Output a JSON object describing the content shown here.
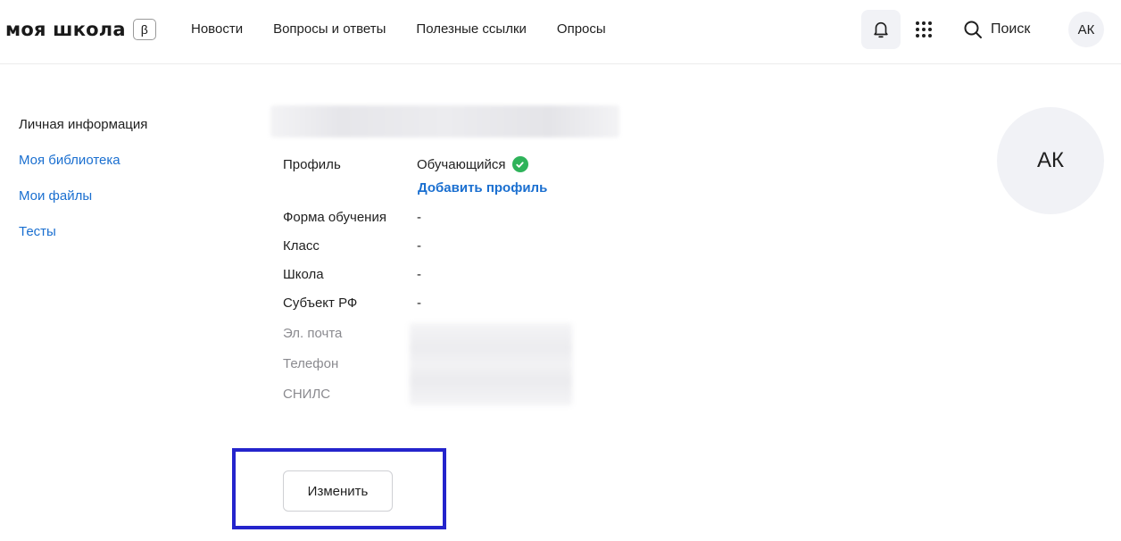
{
  "header": {
    "logo": "моя школа",
    "beta": "β",
    "nav": [
      "Новости",
      "Вопросы и ответы",
      "Полезные ссылки",
      "Опросы"
    ],
    "search_label": "Поиск",
    "user_initials": "АК",
    "icons": {
      "notifications": "bell-icon",
      "apps": "grid-icon",
      "search": "search-icon"
    }
  },
  "sidebar": {
    "items": [
      {
        "label": "Личная информация",
        "active": true
      },
      {
        "label": "Моя библиотека",
        "active": false
      },
      {
        "label": "Мои файлы",
        "active": false
      },
      {
        "label": "Тесты",
        "active": false
      }
    ]
  },
  "profile": {
    "fields": [
      {
        "label": "Профиль",
        "value": "Обучающийся"
      },
      {
        "label": "Форма обучения",
        "value": "-"
      },
      {
        "label": "Класс",
        "value": "-"
      },
      {
        "label": "Школа",
        "value": "-"
      },
      {
        "label": "Субъект РФ",
        "value": "-"
      }
    ],
    "add_profile": "Добавить профиль",
    "contacts": [
      "Эл. почта",
      "Телефон",
      "СНИЛС"
    ],
    "avatar_initials": "АК",
    "edit_button": "Изменить"
  },
  "colors": {
    "link": "#1a6fd0",
    "check": "#2fb35a",
    "highlight": "#2424cc"
  }
}
